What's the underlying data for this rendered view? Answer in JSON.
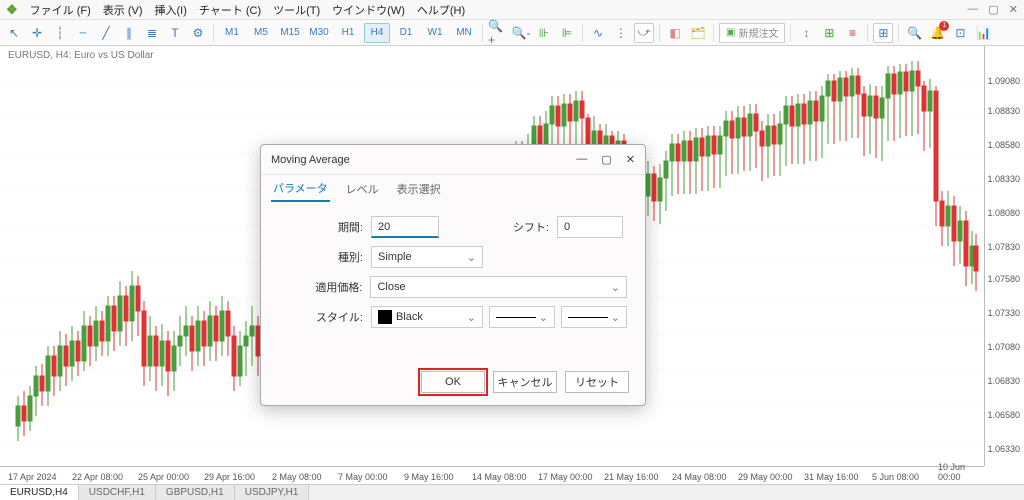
{
  "menu": {
    "items": [
      "ファイル (F)",
      "表示 (V)",
      "挿入(I)",
      "チャート (C)",
      "ツール(T)",
      "ウインドウ(W)",
      "ヘルプ(H)"
    ]
  },
  "toolbar": {
    "timeframes": [
      "M1",
      "M5",
      "M15",
      "M30",
      "H1",
      "H4",
      "D1",
      "W1",
      "MN"
    ],
    "active_tf": "H4",
    "new_order": "新規注文"
  },
  "chart": {
    "title": "EURUSD, H4:  Euro vs US Dollar",
    "y_ticks": [
      "1.09080",
      "1.08830",
      "1.08580",
      "1.08330",
      "1.08080",
      "1.07830",
      "1.07580",
      "1.07330",
      "1.07080",
      "1.06830",
      "1.06580",
      "1.06330"
    ],
    "x_ticks": [
      "17 Apr 2024",
      "22 Apr 08:00",
      "25 Apr 00:00",
      "29 Apr 16:00",
      "2 May 08:00",
      "7 May 00:00",
      "9 May 16:00",
      "14 May 08:00",
      "17 May 00:00",
      "21 May 16:00",
      "24 May 08:00",
      "29 May 00:00",
      "31 May 16:00",
      "5 Jun 08:00",
      "10 Jun 00:00"
    ]
  },
  "tabs": {
    "items": [
      "EURUSD,H4",
      "USDCHF,H1",
      "GBPUSD,H1",
      "USDJPY,H1"
    ],
    "active": 0
  },
  "dialog": {
    "title": "Moving Average",
    "tabs": [
      "パラメータ",
      "レベル",
      "表示選択"
    ],
    "active_tab": 0,
    "labels": {
      "period": "期間:",
      "shift": "シフト:",
      "method": "種別:",
      "apply": "適用価格:",
      "style": "スタイル:"
    },
    "values": {
      "period": "20",
      "shift": "0",
      "method": "Simple",
      "apply": "Close",
      "style_color": "Black"
    },
    "buttons": {
      "ok": "OK",
      "cancel": "キャンセル",
      "reset": "リセット"
    }
  }
}
